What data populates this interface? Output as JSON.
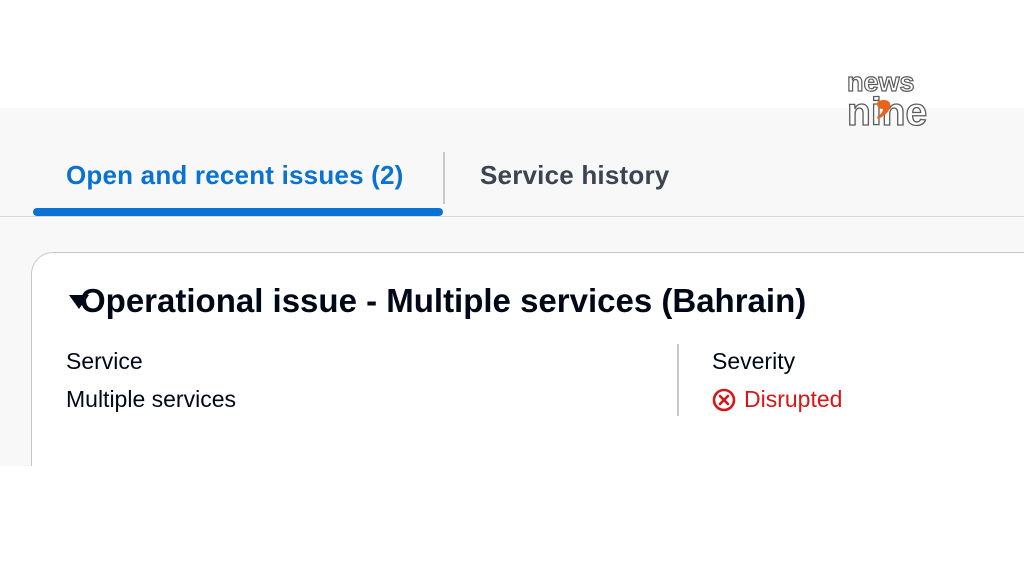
{
  "tabs": {
    "open": "Open and recent issues (2)",
    "history": "Service history"
  },
  "issue": {
    "title": "Operational issue - Multiple services (Bahrain)",
    "service_label": "Service",
    "service_value": "Multiple services",
    "severity_label": "Severity",
    "severity_value": "Disrupted"
  },
  "logo": {
    "line1": "news",
    "line2": "nine"
  },
  "colors": {
    "accent": "#0972d3",
    "error": "#d91515",
    "logo_accent": "#e8641b"
  }
}
